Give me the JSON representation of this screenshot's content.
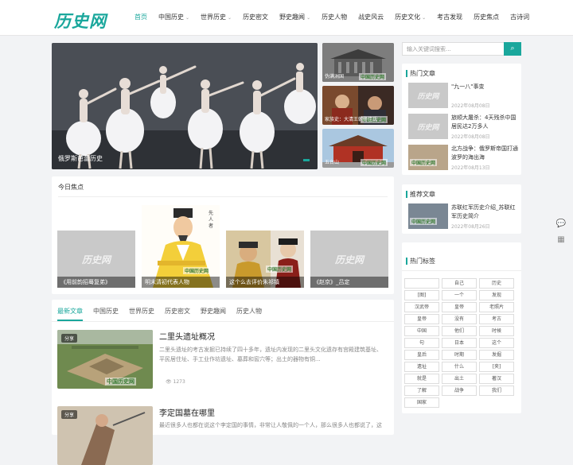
{
  "header": {
    "logo_text": "历史网",
    "nav": [
      {
        "label": "首页",
        "active": true,
        "dropdown": false
      },
      {
        "label": "中国历史",
        "active": false,
        "dropdown": true
      },
      {
        "label": "世界历史",
        "active": false,
        "dropdown": true
      },
      {
        "label": "历史密文",
        "active": false,
        "dropdown": false
      },
      {
        "label": "野史趣闻",
        "active": false,
        "dropdown": true
      },
      {
        "label": "历史人物",
        "active": false,
        "dropdown": false
      },
      {
        "label": "战史风云",
        "active": false,
        "dropdown": false
      },
      {
        "label": "历史文化",
        "active": false,
        "dropdown": true
      },
      {
        "label": "考古发现",
        "active": false,
        "dropdown": false
      },
      {
        "label": "历史焦点",
        "active": false,
        "dropdown": false
      },
      {
        "label": "古诗词",
        "active": false,
        "dropdown": false
      }
    ]
  },
  "hero": {
    "caption": "俄罗斯芭蕾历史",
    "side_items": [
      {
        "caption": "伪满洲国",
        "watermark": "中国历史网"
      },
      {
        "caption": "家族史：大清王朝佟佳氏",
        "watermark": "中国历史网"
      },
      {
        "caption": "五台山",
        "watermark": "中国历史网"
      }
    ]
  },
  "focus": {
    "title": "今日焦点",
    "cards": [
      {
        "caption": "《用前韵招蓦复弟》",
        "placeholder": "历史网"
      },
      {
        "caption": "明末清初代表人物",
        "watermark": "中国历史网"
      },
      {
        "caption": "这个么去评价朱祁镇",
        "watermark": "中国历史网"
      },
      {
        "caption": "《赵京》_吕定",
        "placeholder": "历史网"
      }
    ]
  },
  "article_tabs": [
    "最新文章",
    "中国历史",
    "世界历史",
    "历史密文",
    "野史趣闻",
    "历史人物"
  ],
  "articles": [
    {
      "badge": "分享",
      "title": "二里头遗址概况",
      "excerpt": "二里头遗址的考古发掘已持续了四十多年，遗址内发现的二里头文化遗存有宫殿建筑基址、平民居住址、手工业作坊遗址、墓葬和窖穴等；出土的器物有铜...",
      "views": "1273",
      "watermark": "中国历史网"
    },
    {
      "badge": "分享",
      "title": "李定国墓在哪里",
      "excerpt": "最近很多人也都在说这个李定国的事情，非常让人敬佩的一个人，那么很多人也都说了，这"
    }
  ],
  "sidebar": {
    "search_placeholder": "输入关键词搜索...",
    "search_icon": "search-icon",
    "hot": {
      "title": "热门文章",
      "items": [
        {
          "title": "\"九一八\"事变",
          "date": "2022年08月08日",
          "placeholder": "历史网"
        },
        {
          "title": "旅顺大屠杀：4天残杀中国居民达2万多人",
          "date": "2022年08月08日",
          "placeholder": "历史网"
        },
        {
          "title": "北方战争：俄罗斯帝国打通波罗的海出海",
          "date": "2022年08月13日",
          "watermark": "中国历史网"
        }
      ]
    },
    "recommend": {
      "title": "推荐文章",
      "items": [
        {
          "title": "苏联红军历史介绍_苏联红军历史简介",
          "date": "2022年08月26日",
          "watermark": "中国历史网"
        }
      ]
    },
    "tags": {
      "title": "热门标签",
      "items": [
        "",
        "自己",
        "历史",
        "[图]",
        "一个",
        "发现",
        "汉武帝",
        "皇帝",
        "老照片",
        "皇帝",
        "没有",
        "考古",
        "中国",
        "他们",
        "时候",
        "句",
        "日本",
        "这个",
        "皇后",
        "时期",
        "发掘",
        "遗址",
        "什么",
        "[夹]",
        "就是",
        "出土",
        "著汉",
        "了解",
        "战争",
        "我们",
        "国家"
      ]
    }
  },
  "float_buttons": [
    "chat-icon",
    "qrcode-icon"
  ],
  "colors": {
    "accent": "#1aa79c"
  }
}
